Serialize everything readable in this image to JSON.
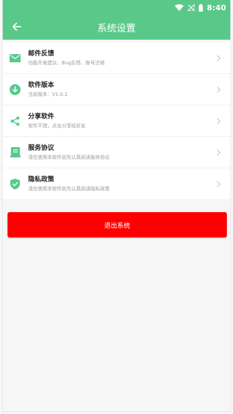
{
  "status_bar": {
    "time": "8:40",
    "icons": [
      "wifi-icon",
      "signal-icon",
      "battery-icon"
    ]
  },
  "header": {
    "title": "系统设置",
    "back_icon": "arrow-left-icon"
  },
  "menu": {
    "items": [
      {
        "title": "邮件反馈",
        "subtitle": "功能开发建议、Bug反馈、账号注销",
        "icon": "mail-icon"
      },
      {
        "title": "软件版本",
        "subtitle": "当前版本：V1.0.1",
        "icon": "download-icon"
      },
      {
        "title": "分享软件",
        "subtitle": "软件不错，点击分享给好友",
        "icon": "share-icon"
      },
      {
        "title": "服务协议",
        "subtitle": "请在使用本软件前先认真阅读服务协议",
        "icon": "document-icon"
      },
      {
        "title": "隐私政策",
        "subtitle": "请在使用本软件前先认真阅读隐私政策",
        "icon": "shield-icon"
      }
    ]
  },
  "logout_label": "退出系统",
  "colors": {
    "primary": "#59c98a",
    "danger": "#ff0000",
    "background": "#f7f7f7"
  }
}
